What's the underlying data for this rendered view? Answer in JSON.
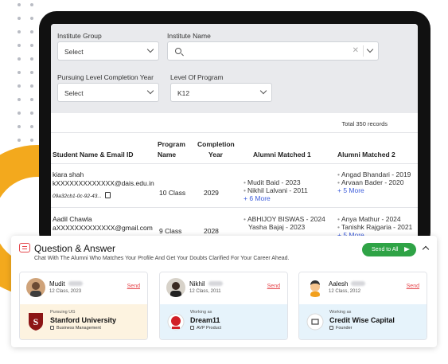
{
  "filters": {
    "institute_group_label": "Institute Group",
    "institute_group_value": "Select",
    "institute_name_label": "Institute Name",
    "pursuing_level_label": "Pursuing Level Completion Year",
    "pursuing_level_value": "Select",
    "program_level_label": "Level Of Program",
    "program_level_value": "K12"
  },
  "table": {
    "total_records": "Total 350 records",
    "headers": {
      "student": "Student Name & Email ID",
      "program_line1": "Program",
      "program_line2": "Name",
      "completion_line1": "Completion",
      "completion_line2": "Year",
      "alumni1": "Alumni Matched 1",
      "alumni2": "Alumni Matched 2"
    },
    "rows": [
      {
        "name": "kiara shah",
        "email": "kXXXXXXXXXXXXX@dais.edu.in",
        "id": "09a32cb1-0c-92-43...",
        "program": "10 Class",
        "year": "2029",
        "alumni1": [
          "Mudit Baid - 2023",
          "Nikhil Lalvani - 2011"
        ],
        "alumni1_more": "+ 6 More",
        "alumni2": [
          "Angad Bhandari - 2019",
          "Arvaan Bader - 2020"
        ],
        "alumni2_more": "+ 5 More"
      },
      {
        "name": "Aadil Chawla",
        "email": "aXXXXXXXXXXXXX@gmail.com",
        "program": "9 Class",
        "year": "2028",
        "alumni1": [
          "ABHIJOY BISWAS - 2024",
          "Yasha Bajaj - 2023"
        ],
        "alumni2": [
          "Anya Mathur - 2024",
          "Tanishk Rajgaria - 2021"
        ],
        "alumni2_more": "+ 5 More"
      }
    ]
  },
  "qa": {
    "title": "Question & Answer",
    "subtitle": "Chat With The Alumni Who Matches Your Profile And Get Your Doubts Clarified For Your Career Ahead.",
    "send_all": "Send to All",
    "cards": [
      {
        "name": "Mudit",
        "class": "12 Class, 2023",
        "send": "Send",
        "status": "Pursuing UG",
        "org": "Stanford University",
        "role": "Business Management",
        "bg": "#fdf3e0"
      },
      {
        "name": "Nikhil",
        "class": "12 Class, 2011",
        "send": "Send",
        "status": "Working as",
        "org": "Dream11",
        "role": "AVP Product",
        "bg": "#e6f3fb"
      },
      {
        "name": "Aalesh",
        "class": "12 Class, 2012",
        "send": "Send",
        "status": "Working as",
        "org": "Credit Wise Capital",
        "role": "Founder",
        "bg": "#e6f3fb"
      }
    ]
  },
  "colors": {
    "accent": "#e5484d",
    "green": "#2fa346",
    "orange": "#f3a91d",
    "link": "#3b5bdb"
  }
}
